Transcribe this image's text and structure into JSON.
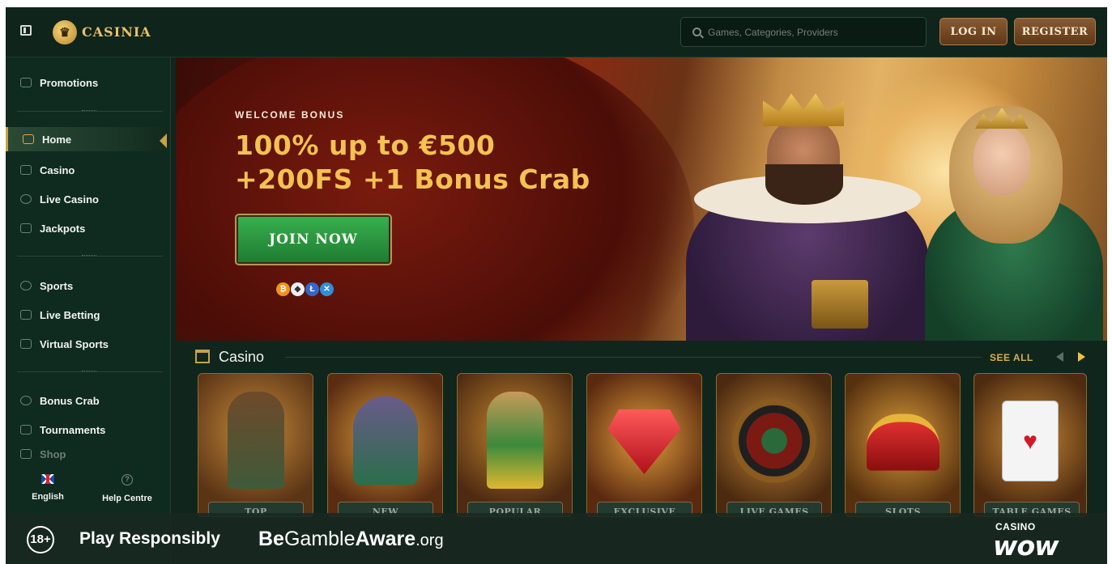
{
  "header": {
    "logo_text": "CASINIA",
    "search_placeholder": "Games, Categories, Providers",
    "login_label": "LOG IN",
    "register_label": "REGISTER"
  },
  "sidebar": {
    "items": [
      {
        "label": "Promotions",
        "icon": "gift-icon"
      },
      {
        "label": "Home",
        "icon": "home-icon",
        "active": true
      },
      {
        "label": "Casino",
        "icon": "casino-icon"
      },
      {
        "label": "Live Casino",
        "icon": "roulette-icon"
      },
      {
        "label": "Jackpots",
        "icon": "seven-icon"
      },
      {
        "label": "Sports",
        "icon": "soccer-ball-icon"
      },
      {
        "label": "Live Betting",
        "icon": "live-betting-icon"
      },
      {
        "label": "Virtual Sports",
        "icon": "gamepad-icon"
      },
      {
        "label": "Bonus Crab",
        "icon": "crab-icon"
      },
      {
        "label": "Tournaments",
        "icon": "trophy-icon"
      },
      {
        "label": "Shop",
        "icon": "shop-icon"
      }
    ],
    "language_label": "English",
    "help_label": "Help Centre"
  },
  "hero": {
    "subtitle": "WELCOME BONUS",
    "title_line1": "100% up to €500",
    "title_line2": "+200FS +1 Bonus Crab",
    "cta_label": "JOIN NOW",
    "crypto_icons": [
      "bitcoin-icon",
      "ethereum-icon",
      "litecoin-icon",
      "ripple-icon"
    ]
  },
  "casino_section": {
    "title": "Casino",
    "see_all_label": "SEE ALL",
    "tiles": [
      "TOP",
      "NEW",
      "POPULAR",
      "EXCLUSIVE",
      "LIVE GAMES",
      "SLOTS",
      "TABLE GAMES"
    ]
  },
  "footer": {
    "age_badge": "18+",
    "play_responsibly": "Play Responsibly",
    "begambleaware_be": "Be",
    "begambleaware_gamble": "Gamble",
    "begambleaware_aware": "Aware",
    "begambleaware_org": ".org",
    "casinowow_top": "CASINO",
    "casinowow_bottom": "wow"
  },
  "colors": {
    "background": "#10261c",
    "accent_gold": "#f2c252",
    "cta_green": "#2e9a44",
    "header_button": "#7a4d2a"
  }
}
